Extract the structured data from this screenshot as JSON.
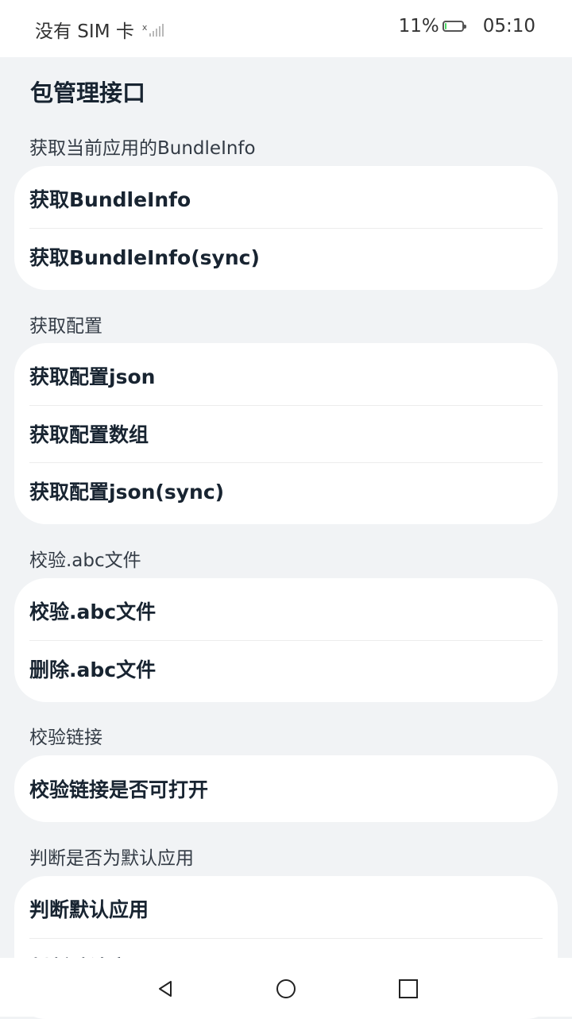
{
  "status_bar": {
    "carrier": "没有 SIM 卡",
    "battery_percent_text": "11%",
    "battery_level": 0.11,
    "time": "05:10"
  },
  "page": {
    "title": "包管理接口"
  },
  "sections": [
    {
      "label": "获取当前应用的BundleInfo",
      "items": [
        "获取BundleInfo",
        "获取BundleInfo(sync)"
      ]
    },
    {
      "label": "获取配置",
      "items": [
        "获取配置json",
        "获取配置数组",
        "获取配置json(sync)"
      ]
    },
    {
      "label": "校验.abc文件",
      "items": [
        "校验.abc文件",
        "删除.abc文件"
      ]
    },
    {
      "label": "校验链接",
      "items": [
        "校验链接是否可打开"
      ]
    },
    {
      "label": "判断是否为默认应用",
      "items": [
        "判断默认应用",
        "判断默认应用(sync)"
      ]
    }
  ],
  "nav_bar": {
    "icons": [
      "back-icon",
      "home-icon",
      "recents-icon"
    ]
  },
  "colors": {
    "background": "#f1f3f5",
    "card": "#ffffff",
    "text": "#182431",
    "battery_fill": "#4cd964"
  }
}
